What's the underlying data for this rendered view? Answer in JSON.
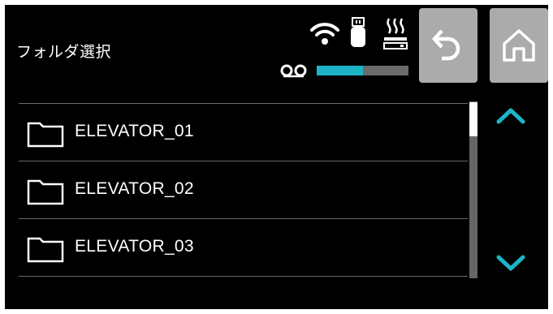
{
  "header": {
    "title": "フォルダ選択"
  },
  "status": {
    "icons": [
      "wifi-icon",
      "usb-icon",
      "heater-icon",
      "tape-icon"
    ],
    "level_fraction": 0.5
  },
  "buttons": {
    "back_icon": "undo-arrow-icon",
    "home_icon": "home-icon"
  },
  "folders": [
    {
      "name": "ELEVATOR_01"
    },
    {
      "name": "ELEVATOR_02"
    },
    {
      "name": "ELEVATOR_03"
    }
  ],
  "scrollbar": {
    "position_fraction": 0.0
  },
  "colors": {
    "background": "#000000",
    "button": "#ababab",
    "accent": "#1db4c8",
    "divider": "#6a6a6a",
    "text": "#ffffff"
  }
}
